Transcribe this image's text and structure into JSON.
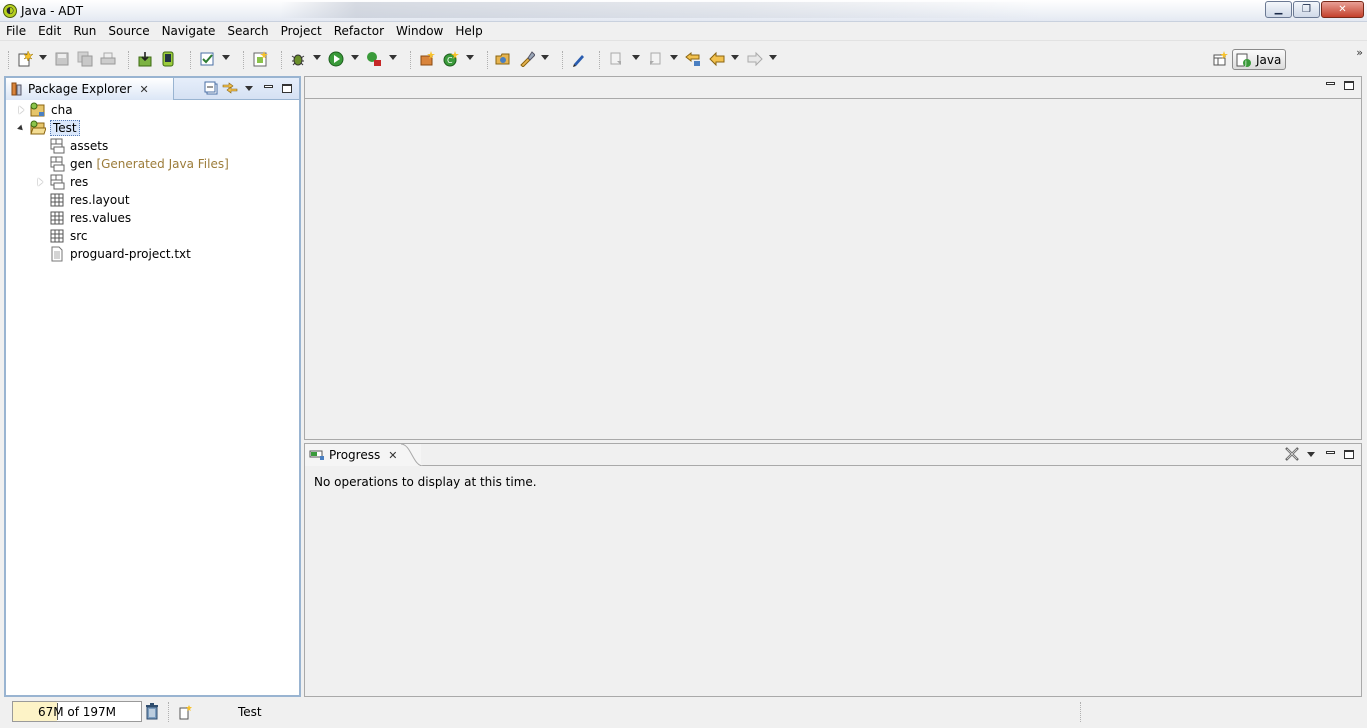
{
  "window": {
    "title": "Java - ADT",
    "icon": "adt-app-icon",
    "buttons": {
      "minimize": "minimize-icon",
      "maximize": "restore-icon",
      "close": "close-icon"
    }
  },
  "menu": [
    "File",
    "Edit",
    "Run",
    "Source",
    "Navigate",
    "Search",
    "Project",
    "Refactor",
    "Window",
    "Help"
  ],
  "toolbar": {
    "perspective_label": "Java",
    "more": "»"
  },
  "package_explorer": {
    "title": "Package Explorer",
    "tree": [
      {
        "label": "cha",
        "icon": "android-project-icon",
        "level": 0,
        "state": "collapsed"
      },
      {
        "label": "Test",
        "icon": "android-project-open-icon",
        "level": 0,
        "state": "expanded",
        "selected": true
      },
      {
        "label": "assets",
        "icon": "folder-package-icon",
        "level": 1
      },
      {
        "label": "gen",
        "decoration": "[Generated Java Files]",
        "icon": "folder-package-icon",
        "level": 1
      },
      {
        "label": "res",
        "icon": "folder-package-icon",
        "level": 1,
        "state": "collapsed"
      },
      {
        "label": "res.layout",
        "icon": "package-icon",
        "level": 1
      },
      {
        "label": "res.values",
        "icon": "package-icon",
        "level": 1
      },
      {
        "label": "src",
        "icon": "package-icon",
        "level": 1
      },
      {
        "label": "proguard-project.txt",
        "icon": "text-file-icon",
        "level": 1
      }
    ]
  },
  "progress_view": {
    "title": "Progress",
    "message": "No operations to display at this time."
  },
  "status_bar": {
    "heap_text": "67M of 197M",
    "heap_used_fraction": 0.34,
    "selection_text": "Test"
  }
}
